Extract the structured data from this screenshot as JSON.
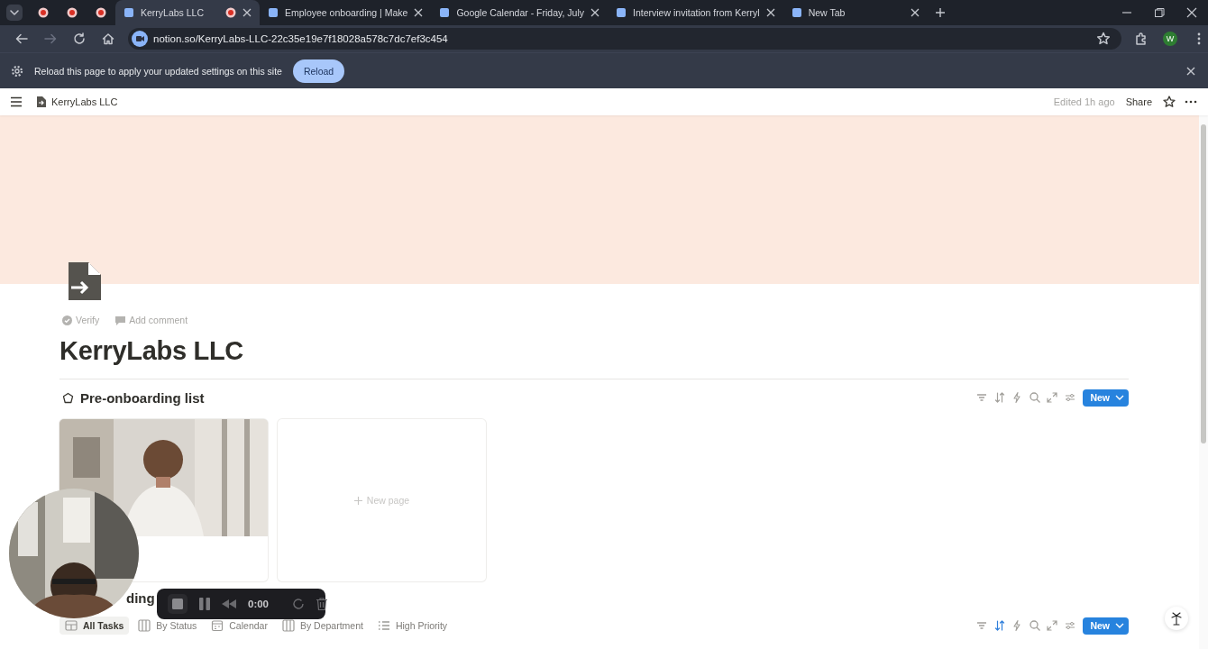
{
  "browser": {
    "tabs": [
      {
        "kind": "pinned",
        "selected": false
      },
      {
        "kind": "pinned",
        "selected": false
      },
      {
        "kind": "pinned",
        "selected": false
      },
      {
        "kind": "page",
        "title": "KerryLabs LLC",
        "selected": true
      },
      {
        "kind": "page",
        "title": "Employee onboarding | Make",
        "selected": false
      },
      {
        "kind": "page",
        "title": "Google Calendar - Friday, July",
        "selected": false
      },
      {
        "kind": "page",
        "title": "Interview invitation from Kerryl",
        "selected": false
      },
      {
        "kind": "page",
        "title": "New Tab",
        "selected": false
      }
    ],
    "address": "notion.so/KerryLabs-LLC-22c35e19e7f18028a578c7dc7ef3c454",
    "profile": "W"
  },
  "infobar": {
    "message": "Reload this page to apply your updated settings on this site",
    "button": "Reload"
  },
  "topbar": {
    "breadcrumb": "KerryLabs LLC",
    "edited": "Edited 1h ago",
    "share": "Share"
  },
  "page": {
    "actions": [
      "Verify",
      "Add comment"
    ],
    "title": "KerryLabs LLC"
  },
  "databases": [
    {
      "title": "Pre-onboarding list",
      "sort_active": false,
      "new_button": "New",
      "cards": [
        {
          "kind": "picture"
        },
        {
          "kind": "new",
          "label": "New page"
        }
      ]
    },
    {
      "title": "ding",
      "sort_active": true,
      "new_button": "New",
      "views": [
        {
          "kind": "table",
          "label": "All Tasks",
          "selected": true
        },
        {
          "kind": "board",
          "label": "By Status",
          "selected": false
        },
        {
          "kind": "calendar",
          "label": "Calendar",
          "selected": false
        },
        {
          "kind": "board",
          "label": "By Department",
          "selected": false
        },
        {
          "kind": "list",
          "label": "High Priority",
          "selected": false
        }
      ]
    }
  ],
  "recorder": {
    "time": "0:00"
  }
}
